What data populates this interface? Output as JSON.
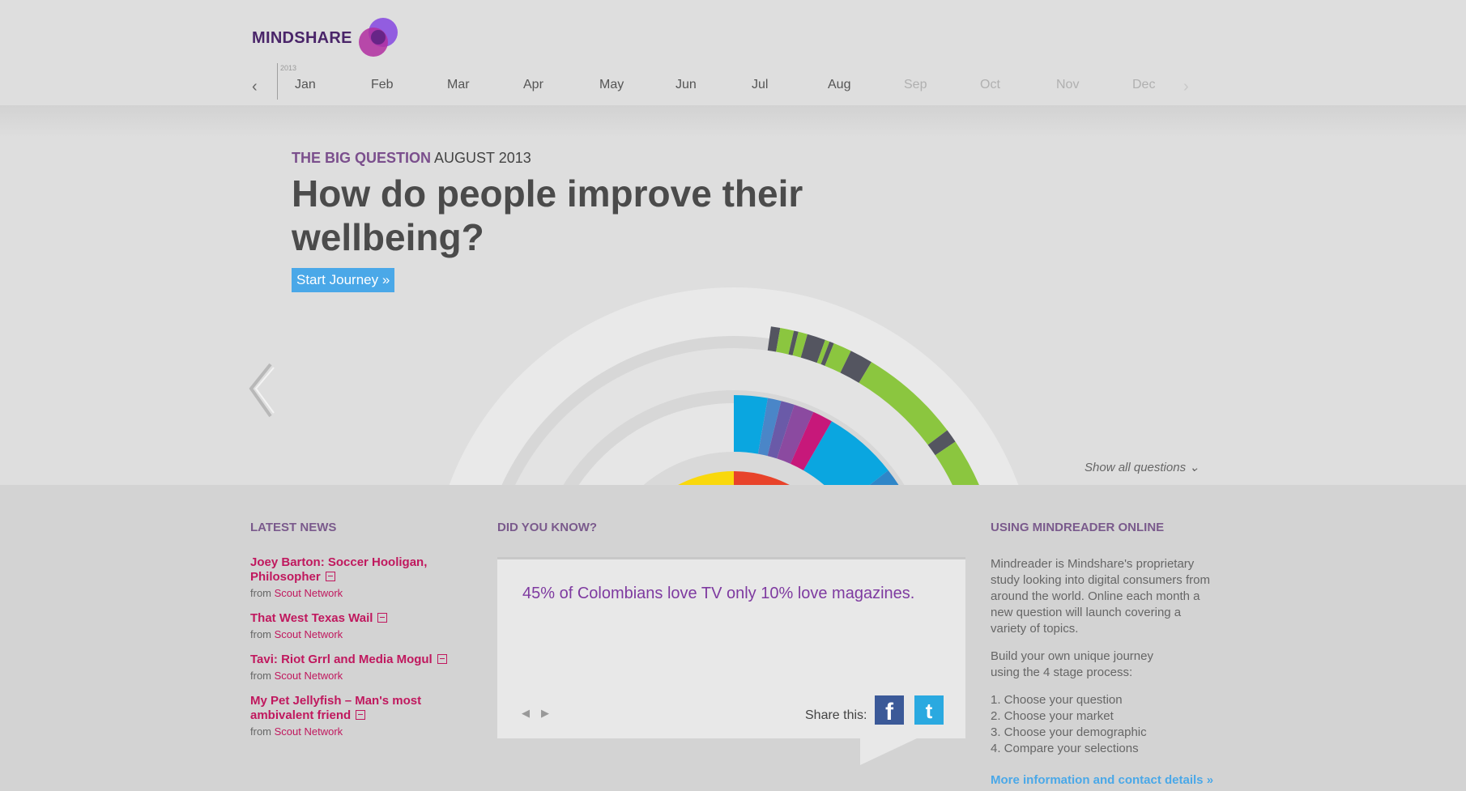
{
  "brand": {
    "logo_text": "MINDSHARE"
  },
  "timeline": {
    "year": "2013",
    "months": [
      {
        "label": "Jan",
        "active": true
      },
      {
        "label": "Feb",
        "active": true
      },
      {
        "label": "Mar",
        "active": true
      },
      {
        "label": "Apr",
        "active": true
      },
      {
        "label": "May",
        "active": true
      },
      {
        "label": "Jun",
        "active": true
      },
      {
        "label": "Jul",
        "active": true
      },
      {
        "label": "Aug",
        "active": true
      },
      {
        "label": "Sep",
        "active": false
      },
      {
        "label": "Oct",
        "active": false
      },
      {
        "label": "Nov",
        "active": false
      },
      {
        "label": "Dec",
        "active": false
      }
    ],
    "prev_icon": "chevron-left-icon",
    "next_icon": "chevron-right-icon"
  },
  "hero": {
    "eyebrow_label": "THE BIG QUESTION",
    "eyebrow_date": "AUGUST 2013",
    "headline": "How do people improve their wellbeing?",
    "cta": "Start Journey »",
    "show_all": "Show all questions"
  },
  "colors": {
    "accent_purple": "#7b4f8d",
    "link_pink": "#c0185e",
    "link_blue": "#4aa8e8",
    "chart_yellow": "#f9d80c",
    "chart_red": "#e8432a",
    "chart_orange": "#f07019",
    "chart_cyan": "#0aa6e0",
    "chart_blue": "#2f86c8",
    "chart_green": "#8bc63f",
    "chart_dark": "#545560",
    "chart_magenta": "#c7187a",
    "chart_violet": "#8b4aa0"
  },
  "news": {
    "title": "LATEST NEWS",
    "items": [
      {
        "headline": "Joey Barton: Soccer Hooligan, Philosopher",
        "from": "from",
        "source": "Scout Network"
      },
      {
        "headline": "That West Texas Wail",
        "from": "from",
        "source": "Scout Network"
      },
      {
        "headline": "Tavi: Riot Grrl and Media Mogul",
        "from": "from",
        "source": "Scout Network"
      },
      {
        "headline": "My Pet Jellyfish – Man's most ambivalent friend",
        "from": "from",
        "source": "Scout Network"
      }
    ]
  },
  "did_you_know": {
    "title": "DID YOU KNOW?",
    "fact": "45% of Colombians love TV only 10% love magazines.",
    "share_label": "Share this:",
    "facebook": "f",
    "twitter": "t"
  },
  "using": {
    "title": "USING MINDREADER ONLINE",
    "para1": "Mindreader is Mindshare's proprietary study looking into digital consumers from around the world. Online each month a new question will launch covering a variety of topics.",
    "para2": "Build your own unique journey using the 4 stage process:",
    "steps": [
      "1.  Choose your question",
      "2.  Choose your market",
      "3.  Choose your demographic",
      "4.  Compare your selections"
    ],
    "more": "More information and contact details »"
  }
}
